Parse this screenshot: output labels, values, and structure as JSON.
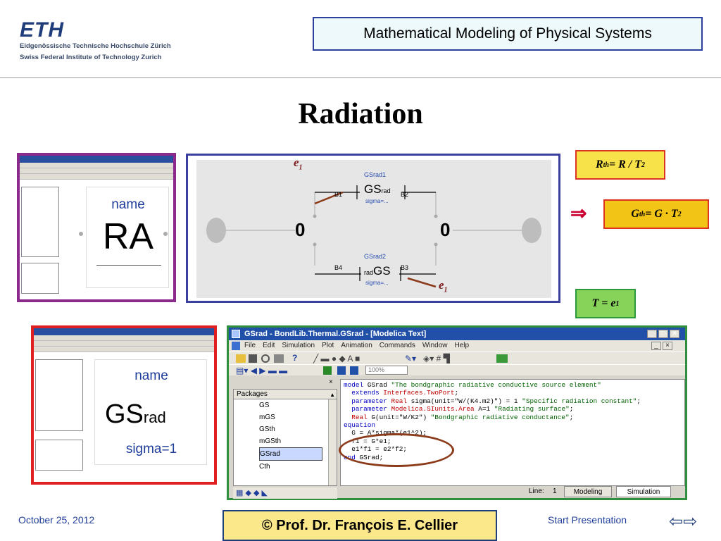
{
  "header": {
    "logo_text": "ETH",
    "logo_sub1": "Eidgenössische Technische Hochschule Zürich",
    "logo_sub2": "Swiss Federal Institute of Technology Zurich",
    "course_title": "Mathematical Modeling of Physical Systems"
  },
  "slide": {
    "title": "Radiation"
  },
  "ra_component": {
    "name_label": "name",
    "big_label": "RA"
  },
  "gs_component": {
    "name_label": "name",
    "big_label": "GS",
    "sub_label": "rad",
    "param_label": "sigma=1"
  },
  "diagram": {
    "top_element": "GSrad1",
    "bottom_element": "GSrad2",
    "gs_text": "GS",
    "gs_sub": "rad",
    "rad_text": "rad",
    "param_top": "sigma=...",
    "param_bottom": "sigma=...",
    "b1": "B1",
    "b2": "B2",
    "b3": "B3",
    "b4": "B4",
    "zero_left": "0",
    "zero_right": "0",
    "e_label_top": "e",
    "e_label_bottom": "e",
    "e_index": "1"
  },
  "formulas": {
    "rth_lhs": "R",
    "rth_sub": "th",
    "rth_rhs": " = R / T ",
    "rth_sup": "2",
    "implies": "⇒",
    "gth_lhs": "G",
    "gth_sub": "th",
    "gth_rhs": " = G · T ",
    "gth_sup": "2",
    "t_lhs": "T = e",
    "t_sub": "1"
  },
  "modelica_window": {
    "title": "GSrad - BondLib.Thermal.GSrad - [Modelica Text]",
    "menu": [
      "File",
      "Edit",
      "Simulation",
      "Plot",
      "Animation",
      "Commands",
      "Window",
      "Help"
    ],
    "zoom": "100%",
    "packages_label": "Packages",
    "package_items": [
      "GS",
      "mGS",
      "GSth",
      "mGSth",
      "GSrad",
      "Cth"
    ],
    "selected_item": "GSrad",
    "line_label": "Line:",
    "line_value": "1",
    "modeling_button": "Modeling",
    "simulation_button": "Simulation",
    "code": {
      "l1a": "model",
      "l1b": " GSrad ",
      "l1c": "\"The bondgraphic radiative conductive source element\"",
      "l2a": "  extends",
      "l2b": " Interfaces.TwoPort",
      "l2c": ";",
      "l3a": "  parameter",
      "l3b": " Real",
      "l3c": " sigma(unit=\"W/(K4.m2)\") = 1 ",
      "l3d": "\"Specific radiation constant\"",
      "l3e": ";",
      "l4a": "  parameter",
      "l4b": " Modelica.SIunits.Area",
      "l4c": " A=1 ",
      "l4d": "\"Radiating surface\"",
      "l4e": ";",
      "l5a": "  Real",
      "l5b": " G(unit=\"W/K2\") ",
      "l5c": "\"Bondgraphic radiative conductance\"",
      "l5d": ";",
      "l6": "equation",
      "l7": "  G = A*sigma*(e1^2);",
      "l8": "  f1 = G*e1;",
      "l9": "  e1*f1 = e2*f2;",
      "l10a": "end",
      "l10b": " GSrad;"
    }
  },
  "footer": {
    "date": "October 25, 2012",
    "author": "©  Prof. Dr. François E. Cellier",
    "start": "Start Presentation",
    "nav": "⇦⇨"
  },
  "colors": {
    "accent_blue": "#1f3d9a",
    "code_keyword": "#0000c0",
    "code_type": "#c00000",
    "code_string": "#006000"
  }
}
